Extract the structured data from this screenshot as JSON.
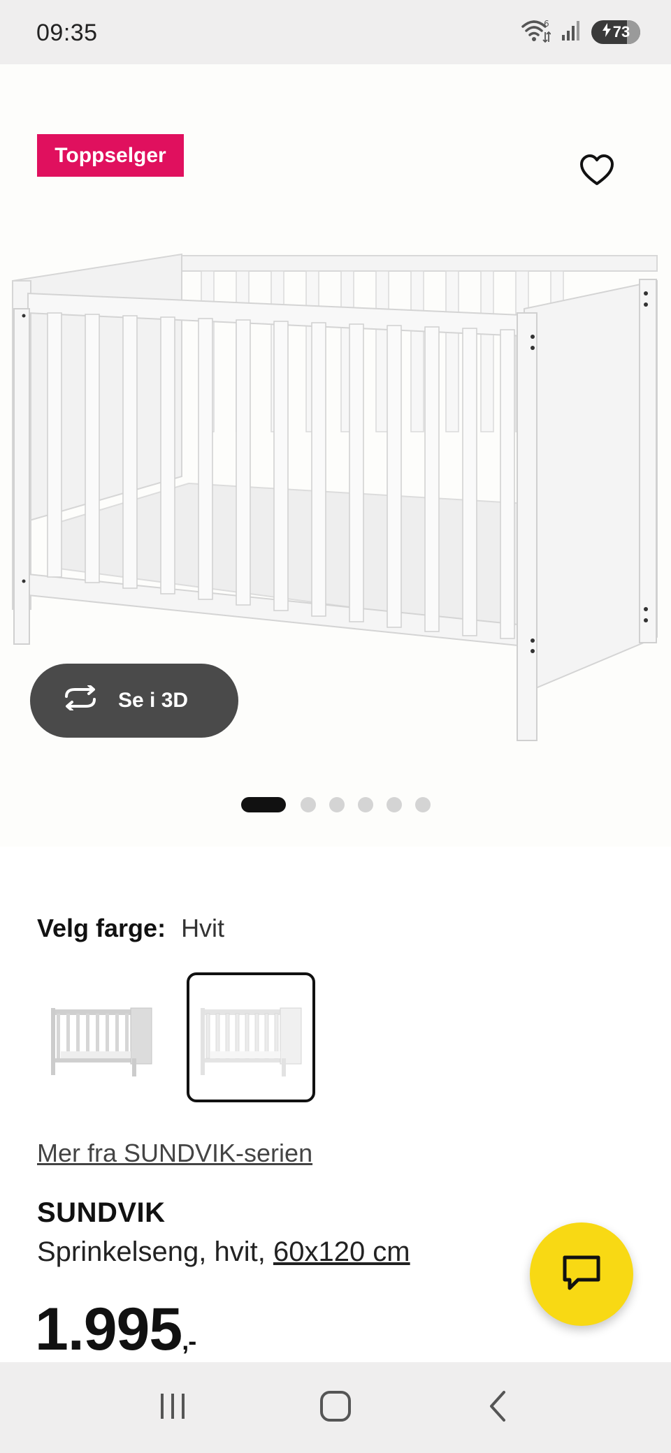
{
  "status_bar": {
    "time": "09:35",
    "battery_level": "73",
    "icons": [
      "wifi-icon",
      "signal-icon",
      "battery-charging-icon"
    ]
  },
  "hero": {
    "badge": "Toppselger",
    "view_3d_label": "Se i 3D",
    "carousel": {
      "total": 6,
      "active": 1
    }
  },
  "color_picker": {
    "label": "Velg farge:",
    "selected_value": "Hvit",
    "swatches": [
      {
        "name": "grey-variant",
        "selected": false
      },
      {
        "name": "white-variant",
        "selected": true
      }
    ]
  },
  "series_link": "Mer fra SUNDVIK-serien",
  "product": {
    "name": "SUNDVIK",
    "description_prefix": "Sprinkelseng, hvit, ",
    "size_link": "60x120 cm",
    "price": "1.995",
    "price_suffix": ",-"
  },
  "colors": {
    "badge": "#e0105e",
    "chat_fab": "#f8d914",
    "button_3d": "#4a4a4a",
    "system_bar": "#efeeee"
  },
  "nav": {
    "icons": [
      "recent-apps-icon",
      "home-icon",
      "back-icon"
    ]
  }
}
